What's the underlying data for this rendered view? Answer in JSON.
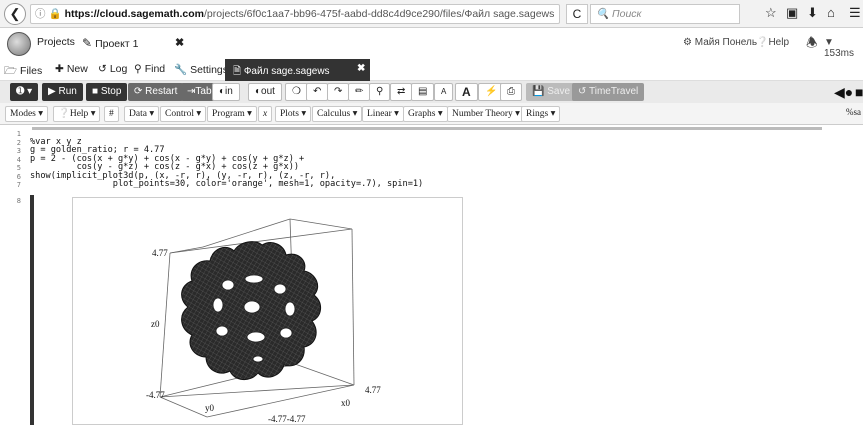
{
  "browser": {
    "url_host": "https://cloud.sagemath.com",
    "url_rest": "/projects/6f0c1aa7-bb96-475f-aabd-dd8c4d9ce290/files/Файл sage.sagews",
    "search_placeholder": "Поиск"
  },
  "header": {
    "projects_label": "Projects",
    "project_tab_label": "Проект 1",
    "user_label": "Майя Понель",
    "help_label": "Help",
    "ping_label": "153ms"
  },
  "filetabs": {
    "files": "Files",
    "new": "New",
    "log": "Log",
    "find": "Find",
    "settings": "Settings",
    "active_file": "Файл sage.sagews"
  },
  "toolbar": {
    "run": "Run",
    "stop": "Stop",
    "restart": "Restart",
    "tab": "Tab",
    "in": "in",
    "out": "out",
    "font_small": "A",
    "font_large": "A",
    "save": "Save",
    "timetravel": "TimeTravel"
  },
  "menus": {
    "modes": "Modes",
    "help": "Help",
    "hash": "#",
    "data": "Data",
    "control": "Control",
    "program": "Program",
    "x": "x",
    "plots": "Plots",
    "calculus": "Calculus",
    "linear": "Linear",
    "graphs": "Graphs",
    "number_theory": "Number Theory",
    "rings": "Rings",
    "right": "%sa"
  },
  "code": {
    "line_numbers": [
      "1",
      "2",
      "3",
      "4",
      "5",
      "6",
      "7",
      "8"
    ],
    "lines": [
      "",
      "%var x y z",
      "g = golden_ratio; r = 4.77",
      "p = 2 - (cos(x + g*y) + cos(x - g*y) + cos(y + g*z) +",
      "         cos(y - g*z) + cos(z - g*x) + cos(z + g*x))",
      "show(implicit_plot3d(p, (x, -r, r), (y, -r, r), (z, -r, r),",
      "                plot_points=30, color='orange', mesh=1, opacity=.7), spin=1)",
      ""
    ]
  },
  "plot": {
    "z_top_label": "4.77",
    "z_mid_label": "z0",
    "z_bottom_label": "-4.77",
    "y_label": "y0",
    "x_label": "x0",
    "x_right_label": "4.77",
    "bottom_pair_label": "-4.77-4.77",
    "mesh_color": "#111111"
  }
}
